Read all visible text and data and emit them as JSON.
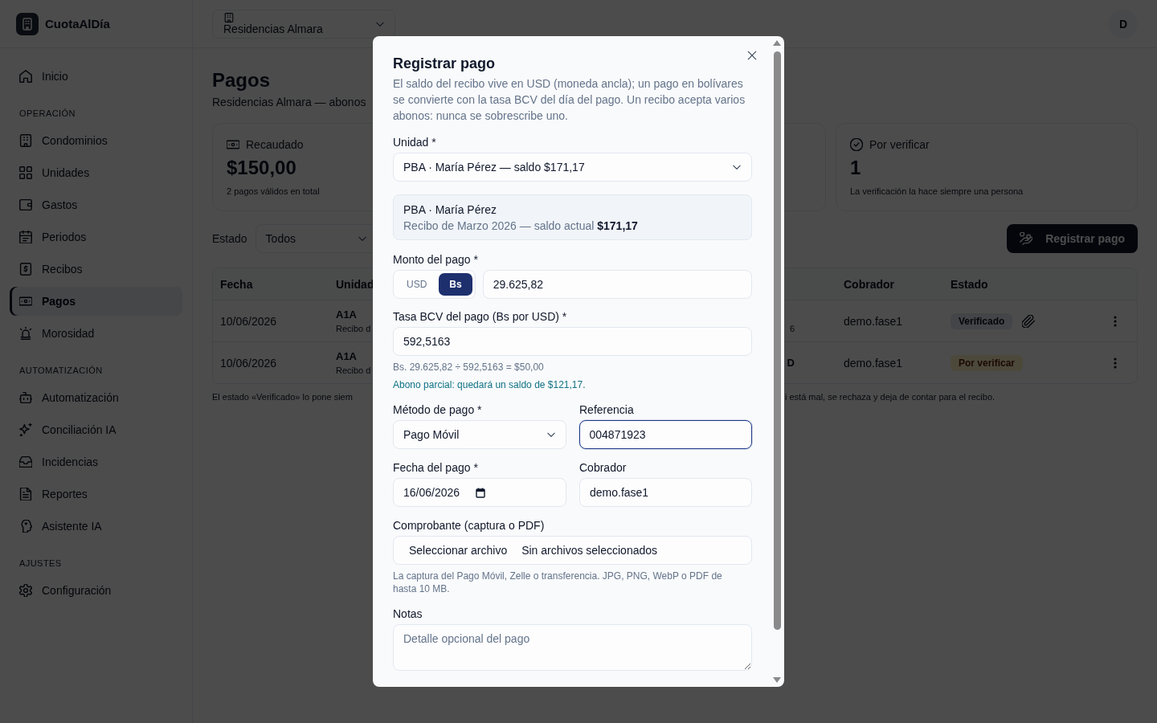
{
  "sidebar": {
    "brand": "CuotaAlDía",
    "items": [
      {
        "kind": "link",
        "label": "Inicio",
        "selected": false
      },
      {
        "kind": "section",
        "label": "OPERACIÓN"
      },
      {
        "kind": "link",
        "label": "Condominios",
        "selected": false
      },
      {
        "kind": "link",
        "label": "Unidades",
        "selected": false
      },
      {
        "kind": "link",
        "label": "Gastos",
        "selected": false
      },
      {
        "kind": "link",
        "label": "Periodos",
        "selected": false
      },
      {
        "kind": "link",
        "label": "Recibos",
        "selected": false
      },
      {
        "kind": "link",
        "label": "Pagos",
        "selected": true
      },
      {
        "kind": "link",
        "label": "Morosidad",
        "selected": false
      },
      {
        "kind": "section",
        "label": "AUTOMATIZACIÓN"
      },
      {
        "kind": "link",
        "label": "Automatización",
        "selected": false
      },
      {
        "kind": "link",
        "label": "Conciliación IA",
        "selected": false
      },
      {
        "kind": "link",
        "label": "Incidencias",
        "selected": false
      },
      {
        "kind": "link",
        "label": "Reportes",
        "selected": false
      },
      {
        "kind": "link",
        "label": "Asistente IA",
        "selected": false
      },
      {
        "kind": "section",
        "label": "AJUSTES"
      },
      {
        "kind": "link",
        "label": "Configuración",
        "selected": false
      }
    ]
  },
  "topbar": {
    "condominium": "Residencias Almara",
    "avatar": "D"
  },
  "page": {
    "title": "Pagos",
    "subtitle": "Residencias Almara — abonos",
    "stat_cards": [
      {
        "label": "Recaudado",
        "value": "$150,00",
        "note": "2 pagos válidos en total"
      },
      {
        "label": "Por verificar",
        "value": "1",
        "note": "La verificación la hace siempre una persona"
      }
    ],
    "filter": {
      "label": "Estado",
      "value": "Todos"
    },
    "register_button": "Registrar pago",
    "table": {
      "columns": [
        "Fecha",
        "Unidad",
        "Cobrador",
        "Estado"
      ],
      "rows": [
        {
          "date": "10/06/2026",
          "unit": {
            "title": "A1A",
            "sub": "Recibo d"
          },
          "column_3": {
            "sub": "6"
          },
          "collector": "demo.fase1",
          "status": {
            "label": "Verificado",
            "kind": "verified"
          },
          "attachment": true
        },
        {
          "date": "10/06/2026",
          "unit": {
            "title": "A1A",
            "sub": "Recibo d"
          },
          "column_3": {
            "title": "D"
          },
          "collector": "demo.fase1",
          "status": {
            "label": "Por verificar",
            "kind": "pending"
          },
          "attachment": false
        }
      ]
    },
    "footnote": [
      "El estado «Verificado» lo pone siem",
      "i está mal, se rechaza y deja de contar para el recibo."
    ]
  },
  "dialog": {
    "title": "Registrar pago",
    "description": "El saldo del recibo vive en USD (moneda ancla); un pago en bolívares se convierte con la tasa BCV del día del pago. Un recibo acepta varios abonos: nunca se sobrescribe uno.",
    "unit": {
      "label": "Unidad *",
      "value": "PBA · María Pérez — saldo $171,17"
    },
    "unit_summary": {
      "title": "PBA · María Pérez",
      "detail": "Recibo de Marzo 2026 — saldo actual **$171,17**"
    },
    "amount": {
      "label": "Monto del pago *",
      "currencies": [
        {
          "label": "USD",
          "selected": false
        },
        {
          "label": "Bs",
          "selected": true
        }
      ],
      "value": "29.625,82"
    },
    "rate": {
      "label": "Tasa BCV del pago (Bs por USD) *",
      "value": "592,5163",
      "calculation": "Bs. 29.625,82 ÷ 592,5163 = $50,00",
      "result": "Abono parcial: quedará un saldo de $121,17."
    },
    "method": {
      "label": "Método de pago *",
      "value": "Pago Móvil"
    },
    "reference": {
      "label": "Referencia",
      "value": "004871923",
      "focused": true
    },
    "date": {
      "label": "Fecha del pago *",
      "value": "16/06/2026"
    },
    "collector": {
      "label": "Cobrador",
      "value": "demo.fase1"
    },
    "receipt": {
      "label": "Comprobante (captura o PDF)",
      "button": "Seleccionar archivo",
      "status": "Sin archivos seleccionados",
      "hint": "La captura del Pago Móvil, Zelle o transferencia. JPG, PNG, WebP o PDF de hasta 10 MB."
    },
    "notes": {
      "label": "Notas",
      "placeholder": "Detalle opcional del pago"
    }
  }
}
